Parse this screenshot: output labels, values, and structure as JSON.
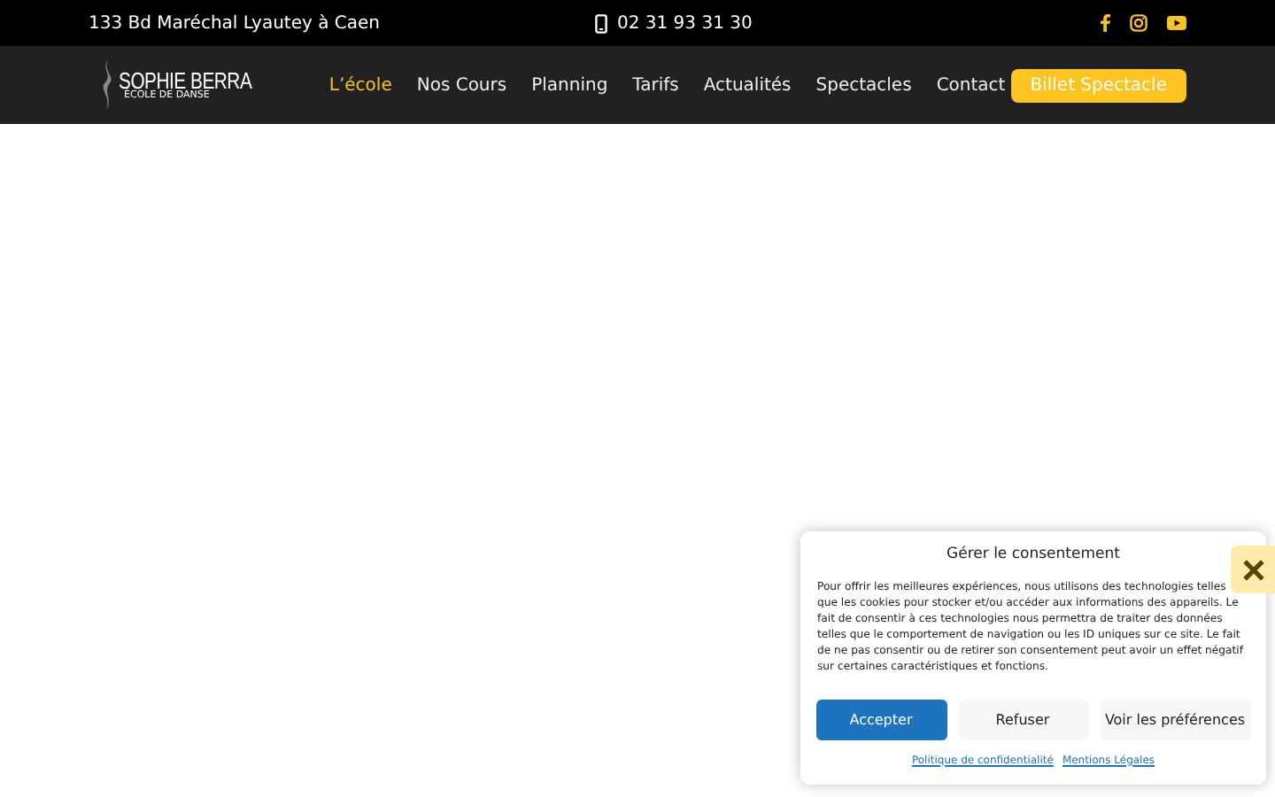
{
  "topbar": {
    "address": "133 Bd Maréchal Lyautey à Caen",
    "phone": "02 31 93 31 30",
    "social": [
      {
        "kind": "facebook"
      },
      {
        "kind": "instagram"
      },
      {
        "kind": "youtube"
      }
    ]
  },
  "logo": {
    "name": "SOPHIE BERRA",
    "subtitle": "ÉCOLE DE DANSE"
  },
  "nav": [
    {
      "label": "L’école",
      "selected": true
    },
    {
      "label": "Nos Cours",
      "selected": false
    },
    {
      "label": "Planning",
      "selected": false
    },
    {
      "label": "Tarifs",
      "selected": false
    },
    {
      "label": "Actualités",
      "selected": false
    },
    {
      "label": "Spectacles",
      "selected": false
    },
    {
      "label": "Contact",
      "selected": false
    }
  ],
  "cta": "Billet Spectacle",
  "consent": {
    "title": "Gérer le consentement",
    "text": "Pour offrir les meilleures expériences, nous utilisons des technologies telles que les cookies pour stocker et/ou accéder aux informations des appareils. Le fait de consentir à ces technologies nous permettra de traiter des données telles que le comportement de navigation ou les ID uniques sur ce site. Le fait de ne pas consentir ou de retirer son consentement peut avoir un effet négatif sur certaines caractéristiques et fonctions.",
    "buttons": [
      {
        "label": "Accepter",
        "kind": "primary"
      },
      {
        "label": "Refuser",
        "kind": "secondary"
      },
      {
        "label": "Voir les préférences",
        "kind": "secondary"
      }
    ],
    "links": [
      "Politique de confidentialité",
      "Mentions Légales"
    ]
  }
}
